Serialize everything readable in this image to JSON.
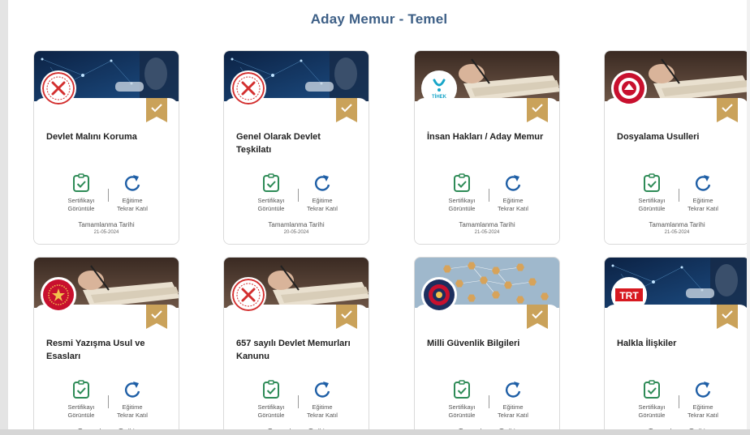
{
  "page": {
    "title": "Aday Memur - Temel"
  },
  "labels": {
    "certificate_line1": "Sertifikayı",
    "certificate_line2": "Görüntüle",
    "retake_line1": "Eğitime",
    "retake_line2": "Tekrar Katıl",
    "completed": "Tamamlanma Tarihi"
  },
  "colors": {
    "accent": "#3d5f86",
    "check_green": "#2e8b57",
    "retake_blue": "#1f5fa6",
    "badge_gold": "#caa25a"
  },
  "courses": [
    {
      "title": "Devlet Malını Koruma",
      "date": "21-05-2024",
      "logo": "dhbb-emblem-icon",
      "image": "tech-network"
    },
    {
      "title": "Genel Olarak Devlet Teşkilatı",
      "date": "20-05-2024",
      "logo": "dhbb-emblem-icon",
      "image": "tech-network"
    },
    {
      "title": "İnsan Hakları / Aday Memur",
      "date": "21-05-2024",
      "logo": "tihek-logo-icon",
      "image": "writing"
    },
    {
      "title": "Dosyalama Usulleri",
      "date": "21-05-2024",
      "logo": "tbmm-emblem-icon",
      "image": "writing"
    },
    {
      "title": "Resmi Yazışma Usul ve Esasları",
      "date": "",
      "logo": "presidency-emblem-icon",
      "image": "writing"
    },
    {
      "title": "657 sayılı Devlet Memurları Kanunu",
      "date": "",
      "logo": "dhbb-emblem-icon",
      "image": "writing"
    },
    {
      "title": "Milli Güvenlik Bilgileri",
      "date": "",
      "logo": "mgk-emblem-icon",
      "image": "hex-network"
    },
    {
      "title": "Halkla İlişkiler",
      "date": "",
      "logo": "trt-logo-icon",
      "logo_text": "TRT",
      "image": "tech-network"
    }
  ]
}
